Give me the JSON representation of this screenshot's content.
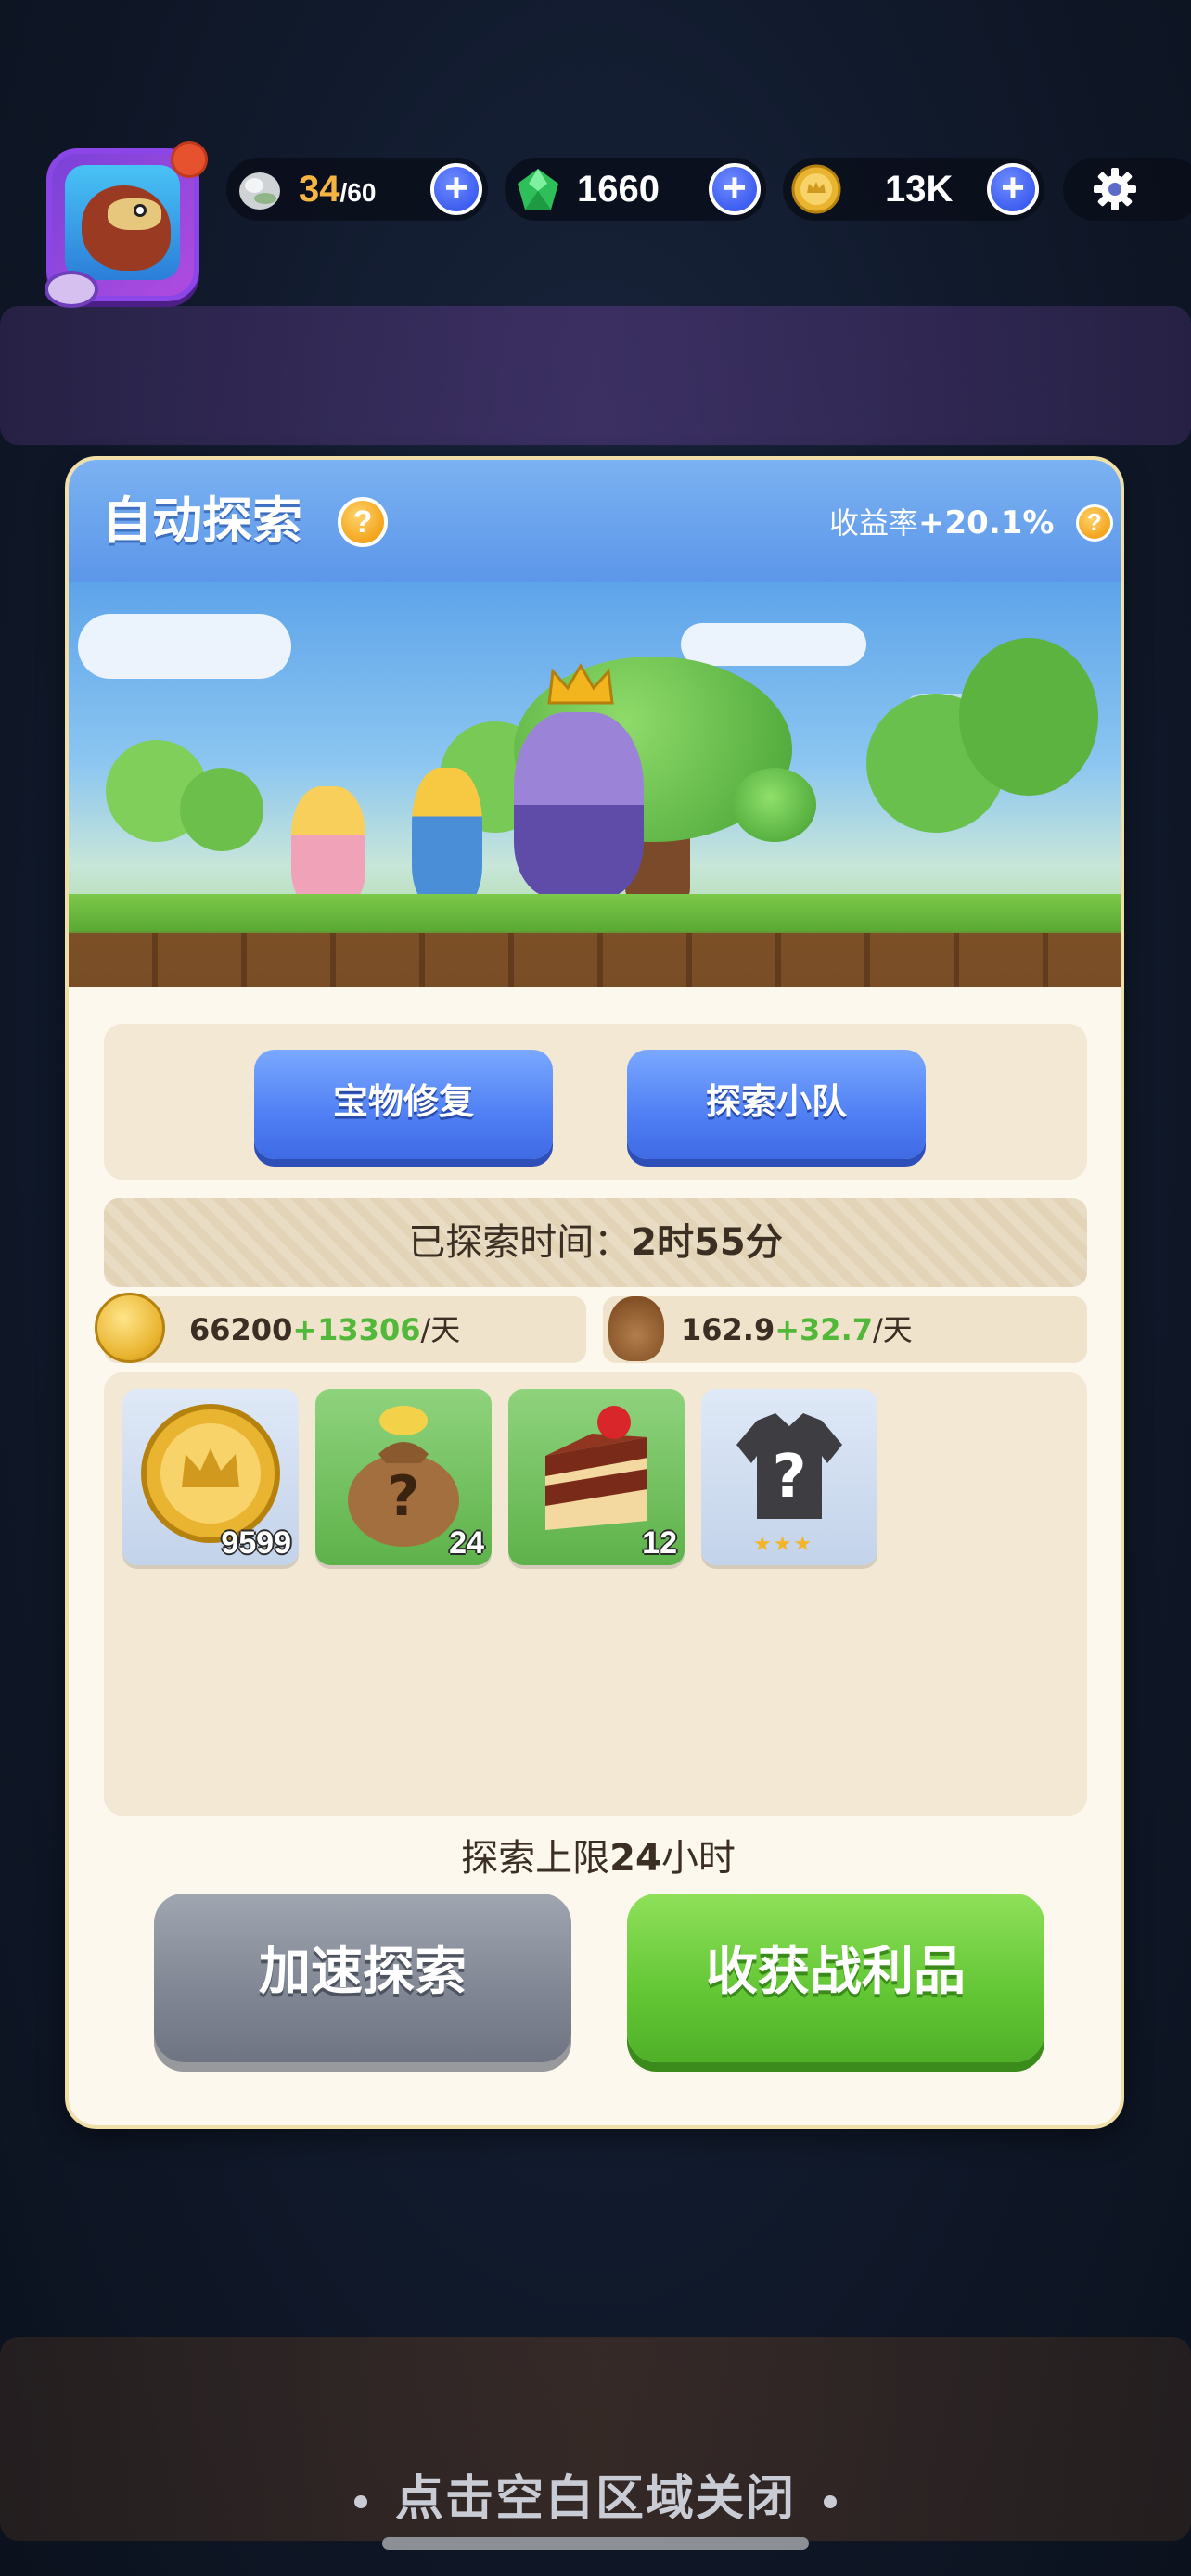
{
  "top_bar": {
    "stamina": {
      "current": "34",
      "max": "/60"
    },
    "gems": "1660",
    "coins": "13K",
    "plus_symbol": "+"
  },
  "panel": {
    "title": "自动探索",
    "rate_label": "收益率",
    "rate_value": "+20.1%",
    "help_symbol": "?",
    "buttons": {
      "treasure_repair": "宝物修复",
      "explore_team": "探索小队"
    },
    "explore_time": {
      "label": "已探索时间：",
      "value": "2时55分"
    },
    "income": {
      "coins": {
        "base": "66200",
        "bonus": "+13306",
        "unit": "/天"
      },
      "bags": {
        "base": "162.9",
        "bonus": "+32.7",
        "unit": "/天"
      }
    },
    "items": [
      {
        "name": "coin",
        "count": "9599"
      },
      {
        "name": "mystery-bag",
        "count": "24"
      },
      {
        "name": "cake",
        "count": "12"
      },
      {
        "name": "unknown-armor",
        "count": ""
      }
    ],
    "limit": {
      "prefix": "探索上限",
      "hours": "24",
      "suffix": "小时"
    },
    "speedup_button": "加速探索",
    "collect_button": "收获战利品"
  },
  "close_hint": "点击空白区域关闭",
  "colors": {
    "header_blue": "#5c96e8",
    "green_button": "#62c634",
    "gray_button": "#7f8592",
    "bonus_green": "#52b83a",
    "panel_bg": "#fcf8ee"
  },
  "icons": {
    "stamina": "gray-stone-icon",
    "gems": "green-gem-icon",
    "coins": "gold-coin-icon",
    "settings": "gear-icon"
  }
}
